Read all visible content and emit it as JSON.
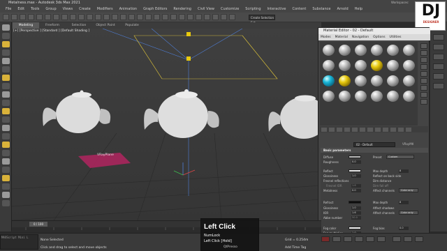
{
  "app": {
    "window_title": "Metalness.max - Autodesk 3ds Max 2021",
    "workspaces_label": "Workspaces:",
    "selection_set": "Create Selection Set"
  },
  "menu": [
    "File",
    "Edit",
    "Tools",
    "Group",
    "Views",
    "Create",
    "Modifiers",
    "Animation",
    "Graph Editors",
    "Rendering",
    "Civil View",
    "Customize",
    "Scripting",
    "Interactive",
    "Content",
    "Substance",
    "Arnold",
    "Help"
  ],
  "ribbon_tabs": [
    {
      "label": "Modeling",
      "active": true
    },
    {
      "label": "Freeform",
      "active": false
    },
    {
      "label": "Selection",
      "active": false
    },
    {
      "label": "Object Paint",
      "active": false
    },
    {
      "label": "Populate",
      "active": false
    }
  ],
  "viewport": {
    "label": "[+] [Perspective ] [Standard ] [Default Shading ]",
    "plane_label": "VRayPlane"
  },
  "material_editor": {
    "title": "Material Editor - 02 - Default",
    "menu": [
      "Modes",
      "Material",
      "Navigation",
      "Options",
      "Utilities"
    ],
    "material_name": "02 - Default",
    "material_type": "VRayMtl",
    "section_title": "Basic parameters",
    "diffuse_label": "Diffuse",
    "roughness_label": "Roughness",
    "roughness_value": "0.0",
    "preset_label": "Preset",
    "preset_value": "Custom",
    "reflect_label": "Reflect",
    "glossiness_label": "Glossiness",
    "glossiness_value": "1.0",
    "fresnel_label": "Fresnel reflections",
    "fresnel_ior_label": "Fresnel IOR",
    "fresnel_ior_value": "1.6",
    "metalness_label": "Metalness",
    "metalness_value": "0.0",
    "max_depth_label": "Max depth",
    "max_depth_value": "8",
    "reflect_back_label": "Reflect on back side",
    "dim_distance_label": "Dim distance",
    "dim_fall_off_label": "Dim fall off",
    "affect_channels_label": "Affect channels",
    "affect_channels_value": "Color only",
    "refract_label": "Refract",
    "refract_gloss_label": "Glossiness",
    "refract_gloss_value": "1.0",
    "ior_label": "IOR",
    "ior_value": "1.6",
    "abbe_label": "Abbe number",
    "abbe_value": "50.0",
    "refract_max_depth_label": "Max depth",
    "refract_max_depth_value": "8",
    "affect_shadows_label": "Affect shadows",
    "refract_affect_channels_label": "Affect channels",
    "refract_affect_channels_value": "Color only",
    "fog_color_label": "Fog color",
    "fog_multiplier_label": "Fog multiplier",
    "fog_multiplier_value": "1.0",
    "fog_bias_label": "Fog bias",
    "fog_bias_value": "0.0",
    "translucency_label": "Translucency",
    "translucency_value": "None",
    "thickness_label": "Thickness",
    "thickness_value": "25.4m",
    "scatter_coeff_label": "Scatter coeff",
    "scatter_coeff_value": "0.0",
    "back_side_color_label": "Back-side color",
    "fwd_bck_coeff_label": "Fwd/bck coeff",
    "fwd_bck_coeff_value": "1.0",
    "light_multiplier_label": "Light multiplier",
    "light_multiplier_value": "1.0",
    "colors": {
      "cyan": "#18b6d8",
      "yellow": "#e8c90e"
    }
  },
  "logo": {
    "text": "DJ",
    "subtext": "DESIGNER"
  },
  "timeline": {
    "frame": "0 / 100"
  },
  "status": {
    "maxscript": "MAXScript Mini L",
    "line1": "None Selected",
    "line2": "Click and drag to select and move objects",
    "grid": "Grid = 0.254m",
    "add_tag": "Add Time Tag"
  },
  "key_overlay": {
    "big": "Left Click",
    "line1": "NumLock",
    "line2": "Left Click [Hold]",
    "line3": "QtPresso"
  }
}
